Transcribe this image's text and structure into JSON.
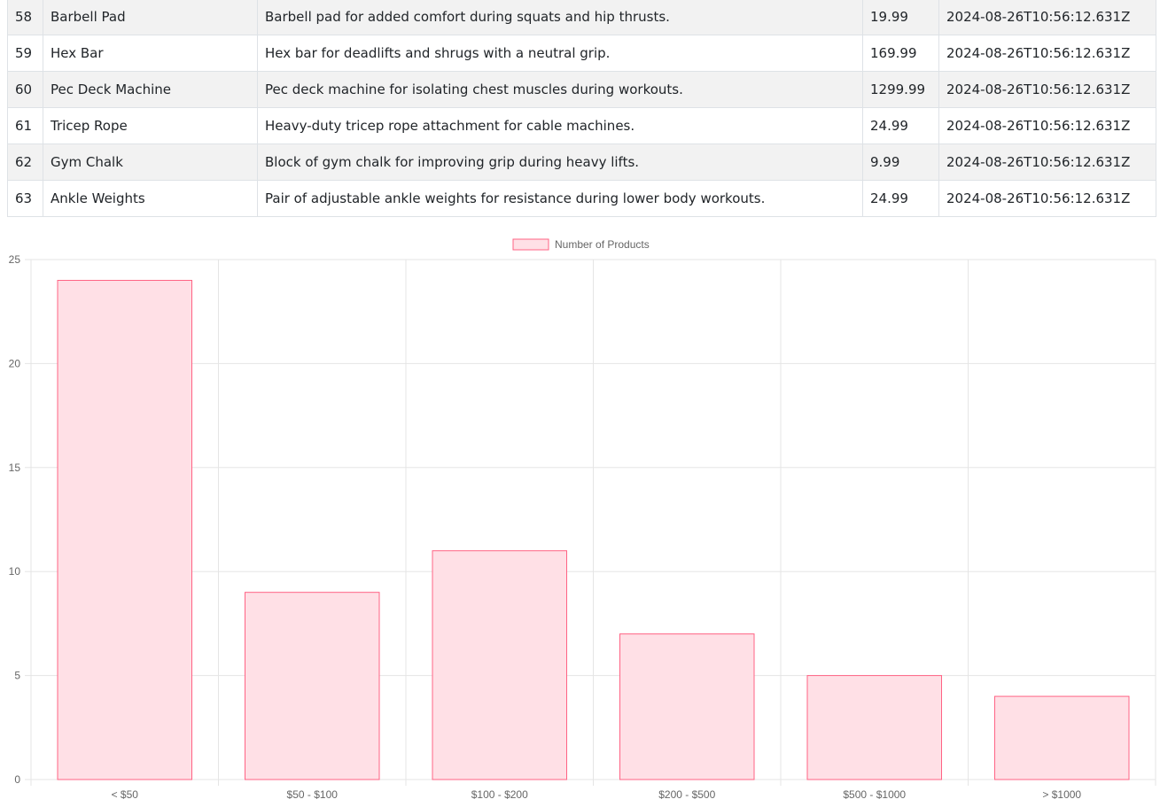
{
  "table": {
    "rows": [
      {
        "id": "58",
        "name": "Barbell Pad",
        "description": "Barbell pad for added comfort during squats and hip thrusts.",
        "price": "19.99",
        "created": "2024-08-26T10:56:12.631Z"
      },
      {
        "id": "59",
        "name": "Hex Bar",
        "description": "Hex bar for deadlifts and shrugs with a neutral grip.",
        "price": "169.99",
        "created": "2024-08-26T10:56:12.631Z"
      },
      {
        "id": "60",
        "name": "Pec Deck Machine",
        "description": "Pec deck machine for isolating chest muscles during workouts.",
        "price": "1299.99",
        "created": "2024-08-26T10:56:12.631Z"
      },
      {
        "id": "61",
        "name": "Tricep Rope",
        "description": "Heavy-duty tricep rope attachment for cable machines.",
        "price": "24.99",
        "created": "2024-08-26T10:56:12.631Z"
      },
      {
        "id": "62",
        "name": "Gym Chalk",
        "description": "Block of gym chalk for improving grip during heavy lifts.",
        "price": "9.99",
        "created": "2024-08-26T10:56:12.631Z"
      },
      {
        "id": "63",
        "name": "Ankle Weights",
        "description": "Pair of adjustable ankle weights for resistance during lower body workouts.",
        "price": "24.99",
        "created": "2024-08-26T10:56:12.631Z"
      }
    ]
  },
  "chart_data": {
    "type": "bar",
    "categories": [
      "< $50",
      "$50 - $100",
      "$100 - $200",
      "$200 - $500",
      "$500 - $1000",
      "> $1000"
    ],
    "series": [
      {
        "name": "Number of Products",
        "values": [
          24,
          9,
          11,
          7,
          5,
          4
        ]
      }
    ],
    "title": "",
    "xlabel": "",
    "ylabel": "",
    "ylim": [
      0,
      25
    ],
    "yticks": [
      0,
      5,
      10,
      15,
      20,
      25
    ],
    "grid": true,
    "legend_position": "top",
    "colors": {
      "bar_fill": "#ffe0e6",
      "bar_border": "#ff6384",
      "grid": "#e5e5e5",
      "tick_text": "#666666"
    }
  }
}
